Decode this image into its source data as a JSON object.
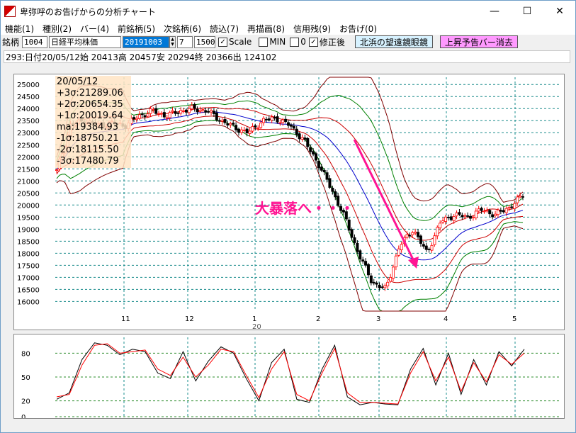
{
  "window": {
    "title": "卑弥呼のお告げからの分析チャート",
    "minimize": "—",
    "maximize": "☐",
    "close": "✕"
  },
  "menu": [
    "機能(1)",
    "種別(2)",
    "バー(4)",
    "前銘柄(5)",
    "次銘柄(6)",
    "読込(7)",
    "再描画(8)",
    "信用残(9)",
    "お告げ(0)"
  ],
  "toolbar": {
    "label": "銘柄",
    "code": "1004",
    "name": "日経平均株価",
    "date": "20191003",
    "span": "7",
    "count": "1500",
    "scale_label": "Scale",
    "scale_checked": true,
    "min_label": "MIN",
    "min_checked": false,
    "zero_value": "0",
    "adjusted_label": "修正後",
    "adjusted_checked": true,
    "button_a": "北浜の望遠鏡眼鏡",
    "button_b": "上昇予告バー消去"
  },
  "info": "293:日付20/05/12始 20413高 20457安 20294終 20366出 124102",
  "legend": [
    "20/05/12",
    "+3σ:21289.06",
    "+2σ:20654.35",
    "+1σ:20019.64",
    " ma:19384.93",
    "-1σ:18750.21",
    "-2σ:18115.50",
    "-3σ:17480.79"
  ],
  "annotation": "大暴落へ・・・",
  "colors": {
    "up": "#ff0000",
    "down": "#000000",
    "ma": "#0000cc",
    "band2": "#008000",
    "band1": "#cc0000",
    "band3": "#800000",
    "arrow": "#ff1493",
    "grid": "#1a8c8c"
  },
  "chart_data": [
    {
      "type": "candlestick",
      "ylim": [
        15600,
        25300
      ],
      "y_ticks": [
        25000,
        24500,
        24000,
        23500,
        23000,
        22500,
        22000,
        21500,
        21000,
        20500,
        20000,
        19500,
        19000,
        18500,
        18000,
        17500,
        17000,
        16500,
        16000
      ],
      "x_tick_labels": [
        "11",
        "12",
        "1",
        "2",
        "3",
        "4",
        "5"
      ],
      "x_sublabel": "20",
      "close_path": [
        21400,
        23300,
        23500,
        23300,
        23400,
        23300,
        23700,
        23900,
        23700,
        23900,
        24000,
        23900,
        23500,
        23200,
        23000,
        23500,
        23600,
        23300,
        22700,
        21800,
        20700,
        19500,
        18000,
        16800,
        16500,
        18300,
        19000,
        18000,
        19300,
        19600,
        19500,
        19800,
        19600,
        19900,
        20400
      ]
    },
    {
      "type": "line",
      "ylim": [
        0,
        100
      ],
      "y_ticks": [
        80,
        50,
        20,
        0
      ],
      "series": [
        {
          "values": [
            22,
            30,
            72,
            93,
            90,
            78,
            85,
            82,
            55,
            48,
            82,
            45,
            70,
            88,
            80,
            48,
            20,
            68,
            85,
            22,
            18,
            60,
            90,
            25,
            15,
            18,
            16,
            15,
            60,
            86,
            40,
            80,
            28,
            72,
            40,
            82,
            64,
            85
          ]
        },
        {
          "values": [
            25,
            28,
            65,
            90,
            92,
            80,
            82,
            84,
            60,
            52,
            75,
            50,
            65,
            85,
            82,
            52,
            24,
            60,
            82,
            28,
            20,
            55,
            86,
            30,
            18,
            18,
            17,
            16,
            55,
            82,
            45,
            75,
            32,
            68,
            44,
            78,
            66,
            80
          ]
        }
      ]
    }
  ]
}
